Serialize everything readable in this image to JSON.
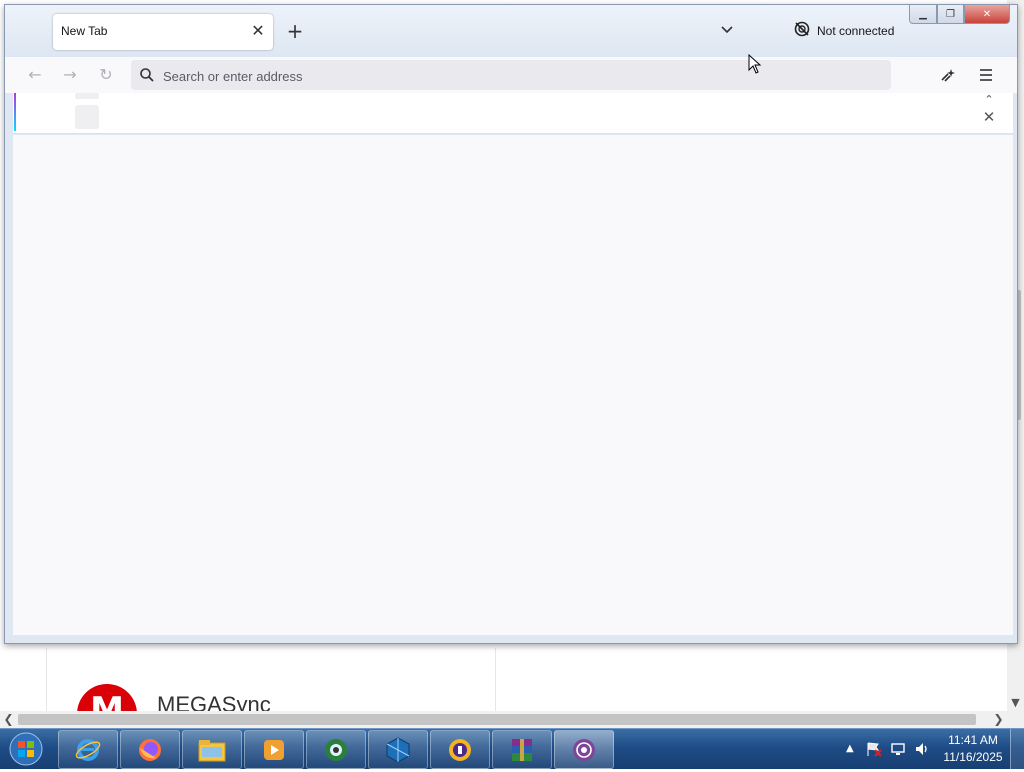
{
  "browser": {
    "tab": {
      "title": "New Tab"
    },
    "vpn": {
      "status": "Not connected"
    },
    "url_bar": {
      "placeholder": "Search or enter address",
      "value": ""
    }
  },
  "background_page": {
    "brand_text": "MEGASync",
    "logo_letter": "M"
  },
  "taskbar": {
    "apps": [
      "internet-explorer",
      "firefox",
      "file-explorer",
      "media-player",
      "network-tool",
      "virtualbox",
      "vpn-client",
      "winrar",
      "tor-browser"
    ],
    "clock": {
      "time": "11:41 AM",
      "date": "11/16/2025"
    }
  },
  "colors": {
    "accent_gradient_start": "#b833e1",
    "accent_gradient_end": "#00ddff",
    "taskbar": "#1f4c86",
    "mega_red": "#d90007"
  }
}
